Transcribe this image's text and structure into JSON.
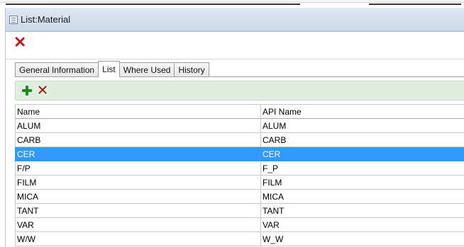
{
  "window": {
    "title": "List:Material",
    "title_icon": "list-window-icon",
    "toolbar": {
      "close_icon": "close-red-x-icon"
    }
  },
  "tabs": [
    {
      "label": "General Information",
      "active": false
    },
    {
      "label": "List",
      "active": true
    },
    {
      "label": "Where Used",
      "active": false
    },
    {
      "label": "History",
      "active": false
    }
  ],
  "list_toolbar": {
    "add_icon": "green-plus-icon",
    "delete_icon": "red-x-icon"
  },
  "table": {
    "columns": [
      "Name",
      "API Name"
    ],
    "rows": [
      {
        "name": "ALUM",
        "api_name": "ALUM"
      },
      {
        "name": "CARB",
        "api_name": "CARB"
      },
      {
        "name": "CER",
        "api_name": "CER",
        "selected": true
      },
      {
        "name": "F/P",
        "api_name": "F_P"
      },
      {
        "name": "FILM",
        "api_name": "FILM"
      },
      {
        "name": "MICA",
        "api_name": "MICA"
      },
      {
        "name": "TANT",
        "api_name": "TANT"
      },
      {
        "name": "VAR",
        "api_name": "VAR"
      },
      {
        "name": "W/W",
        "api_name": "W_W"
      }
    ]
  },
  "colors": {
    "selection": "#3399ff",
    "list_toolbar_bg": "#dfeedd",
    "titlebar_bg": "#d5e0ee"
  }
}
